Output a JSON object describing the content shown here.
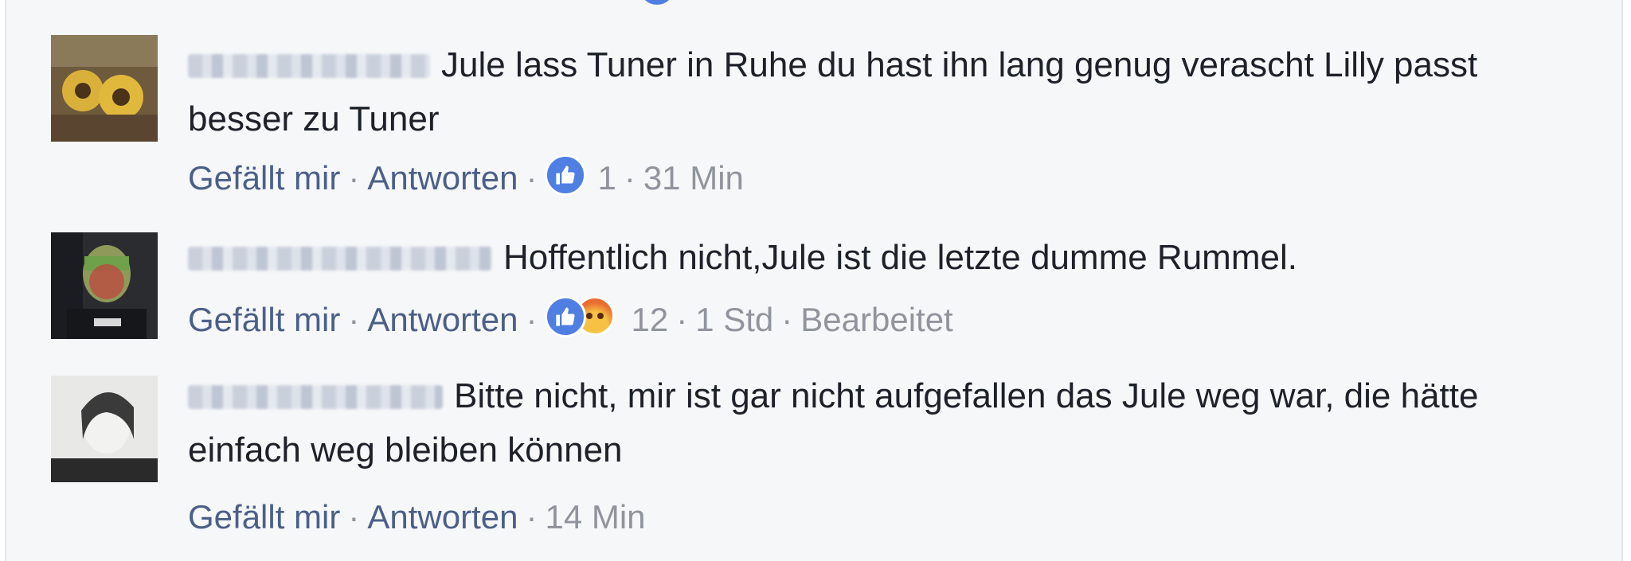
{
  "comments": [
    {
      "text": "Jule lass Tuner in Ruhe du hast ihn lang genug verascht Lilly passt besser zu Tuner",
      "actions": {
        "like": "Gefällt mir",
        "reply": "Antworten"
      },
      "reactions": {
        "types": [
          "like-icon"
        ],
        "count": "1"
      },
      "time": "31 Min",
      "edited": ""
    },
    {
      "text": "Hoffentlich nicht,Jule ist die letzte dumme Rummel.",
      "actions": {
        "like": "Gefällt mir",
        "reply": "Antworten"
      },
      "reactions": {
        "types": [
          "like-icon",
          "angry-icon"
        ],
        "count": "12"
      },
      "time": "1 Std",
      "edited": "Bearbeitet"
    },
    {
      "text": "Bitte nicht, mir ist gar nicht aufgefallen das Jule weg war, die hätte einfach weg bleiben können",
      "actions": {
        "like": "Gefällt mir",
        "reply": "Antworten"
      },
      "reactions": null,
      "time": "14 Min",
      "edited": ""
    }
  ],
  "colors": {
    "background": "#f6f7f9",
    "link": "#4b5f88",
    "meta": "#90949c",
    "text": "#1d2129",
    "like_blue": "#4f7fe3"
  }
}
